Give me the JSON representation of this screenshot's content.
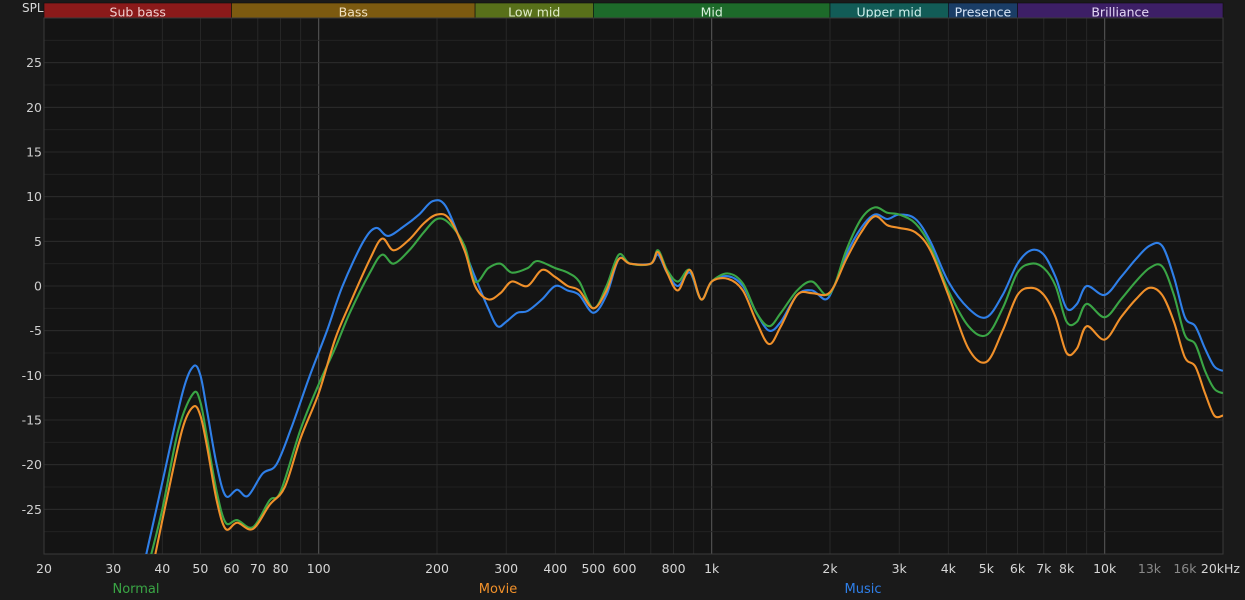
{
  "spl_label": "SPL",
  "bands": [
    {
      "label": "Sub bass",
      "from": 20,
      "to": 60,
      "color": "#8b1a1a",
      "text_color": "#f0d0d0"
    },
    {
      "label": "Bass",
      "from": 60,
      "to": 250,
      "color": "#7c5a10",
      "text_color": "#f0e0c0"
    },
    {
      "label": "Low mid",
      "from": 250,
      "to": 500,
      "color": "#58701a",
      "text_color": "#e0ecc8"
    },
    {
      "label": "Mid",
      "from": 500,
      "to": 2000,
      "color": "#1d6a2a",
      "text_color": "#d8f0dc"
    },
    {
      "label": "Upper mid",
      "from": 2000,
      "to": 4000,
      "color": "#125c57",
      "text_color": "#d0f0ec"
    },
    {
      "label": "Presence",
      "from": 4000,
      "to": 6000,
      "color": "#1a3d66",
      "text_color": "#d8e6f8"
    },
    {
      "label": "Brilliance",
      "from": 6000,
      "to": 20000,
      "color": "#3d1f66",
      "text_color": "#e4d8f6"
    }
  ],
  "legend": [
    {
      "label": "Normal",
      "color": "#3aa545"
    },
    {
      "label": "Movie",
      "color": "#f0902a"
    },
    {
      "label": "Music",
      "color": "#2f7fe8"
    }
  ],
  "chart_data": {
    "type": "line",
    "xscale": "log",
    "xlim": [
      20,
      20000
    ],
    "ylim": [
      -30,
      30
    ],
    "grid": true,
    "ylabel": "SPL",
    "yticks": [
      25,
      20,
      15,
      10,
      5,
      0,
      -5,
      -10,
      -15,
      -20,
      -25
    ],
    "xticks": [
      {
        "v": 20,
        "label": "20",
        "dim": false
      },
      {
        "v": 30,
        "label": "30",
        "dim": false
      },
      {
        "v": 40,
        "label": "40",
        "dim": false
      },
      {
        "v": 50,
        "label": "50",
        "dim": false
      },
      {
        "v": 60,
        "label": "60",
        "dim": false
      },
      {
        "v": 70,
        "label": "70",
        "dim": false
      },
      {
        "v": 80,
        "label": "80",
        "dim": false
      },
      {
        "v": 100,
        "label": "100",
        "dim": false
      },
      {
        "v": 200,
        "label": "200",
        "dim": false
      },
      {
        "v": 300,
        "label": "300",
        "dim": false
      },
      {
        "v": 400,
        "label": "400",
        "dim": false
      },
      {
        "v": 500,
        "label": "500",
        "dim": false
      },
      {
        "v": 600,
        "label": "600",
        "dim": false
      },
      {
        "v": 800,
        "label": "800",
        "dim": false
      },
      {
        "v": 1000,
        "label": "1k",
        "dim": false
      },
      {
        "v": 2000,
        "label": "2k",
        "dim": false
      },
      {
        "v": 3000,
        "label": "3k",
        "dim": false
      },
      {
        "v": 4000,
        "label": "4k",
        "dim": false
      },
      {
        "v": 5000,
        "label": "5k",
        "dim": false
      },
      {
        "v": 6000,
        "label": "6k",
        "dim": false
      },
      {
        "v": 7000,
        "label": "7k",
        "dim": false
      },
      {
        "v": 8000,
        "label": "8k",
        "dim": false
      },
      {
        "v": 10000,
        "label": "10k",
        "dim": false
      },
      {
        "v": 13000,
        "label": "13k",
        "dim": true
      },
      {
        "v": 16000,
        "label": "16k",
        "dim": true
      },
      {
        "v": 20000,
        "label": "20kHz",
        "dim": false
      }
    ],
    "series": [
      {
        "name": "Music",
        "color": "#2f7fe8",
        "points": [
          [
            36,
            -31
          ],
          [
            40,
            -22
          ],
          [
            45,
            -12
          ],
          [
            48,
            -9
          ],
          [
            50,
            -10
          ],
          [
            52,
            -14
          ],
          [
            55,
            -20
          ],
          [
            58,
            -23.5
          ],
          [
            62,
            -22.8
          ],
          [
            66,
            -23.5
          ],
          [
            72,
            -21
          ],
          [
            78,
            -20
          ],
          [
            85,
            -16
          ],
          [
            95,
            -10
          ],
          [
            105,
            -5
          ],
          [
            115,
            0
          ],
          [
            130,
            5
          ],
          [
            140,
            6.5
          ],
          [
            150,
            5.6
          ],
          [
            165,
            6.7
          ],
          [
            180,
            8
          ],
          [
            195,
            9.5
          ],
          [
            210,
            9
          ],
          [
            230,
            5
          ],
          [
            250,
            1
          ],
          [
            270,
            -2.5
          ],
          [
            285,
            -4.5
          ],
          [
            300,
            -4
          ],
          [
            320,
            -3
          ],
          [
            340,
            -2.8
          ],
          [
            370,
            -1.5
          ],
          [
            400,
            0
          ],
          [
            430,
            -0.5
          ],
          [
            460,
            -1
          ],
          [
            500,
            -3
          ],
          [
            540,
            -1
          ],
          [
            580,
            3
          ],
          [
            620,
            2.5
          ],
          [
            700,
            2.5
          ],
          [
            730,
            3.5
          ],
          [
            770,
            1.5
          ],
          [
            820,
            0
          ],
          [
            880,
            1.5
          ],
          [
            940,
            -1.5
          ],
          [
            1000,
            0.5
          ],
          [
            1100,
            1.1
          ],
          [
            1200,
            0
          ],
          [
            1300,
            -3
          ],
          [
            1400,
            -5
          ],
          [
            1500,
            -4
          ],
          [
            1650,
            -1
          ],
          [
            1800,
            -0.5
          ],
          [
            1950,
            -1.5
          ],
          [
            2050,
            0
          ],
          [
            2200,
            3.5
          ],
          [
            2400,
            6.5
          ],
          [
            2600,
            8
          ],
          [
            2800,
            7.5
          ],
          [
            3000,
            8
          ],
          [
            3300,
            7.5
          ],
          [
            3600,
            5
          ],
          [
            4000,
            0.5
          ],
          [
            4500,
            -2.5
          ],
          [
            5000,
            -3.5
          ],
          [
            5500,
            -1
          ],
          [
            6000,
            2.5
          ],
          [
            6500,
            4
          ],
          [
            7000,
            3.5
          ],
          [
            7500,
            1
          ],
          [
            8000,
            -2.5
          ],
          [
            8500,
            -2
          ],
          [
            9000,
            0
          ],
          [
            10000,
            -1
          ],
          [
            11000,
            1
          ],
          [
            12000,
            3
          ],
          [
            13000,
            4.5
          ],
          [
            14000,
            4.5
          ],
          [
            15000,
            1
          ],
          [
            16000,
            -3.5
          ],
          [
            17000,
            -4.5
          ],
          [
            18000,
            -7
          ],
          [
            19000,
            -9
          ],
          [
            20000,
            -9.5
          ]
        ]
      },
      {
        "name": "Normal",
        "color": "#3aa545",
        "points": [
          [
            37,
            -31
          ],
          [
            40,
            -25
          ],
          [
            44,
            -16
          ],
          [
            48,
            -12
          ],
          [
            50,
            -13
          ],
          [
            52,
            -17
          ],
          [
            55,
            -23
          ],
          [
            58,
            -26.5
          ],
          [
            62,
            -26.2
          ],
          [
            68,
            -27
          ],
          [
            75,
            -24
          ],
          [
            80,
            -23
          ],
          [
            90,
            -16
          ],
          [
            100,
            -11
          ],
          [
            110,
            -7
          ],
          [
            120,
            -3
          ],
          [
            135,
            1.5
          ],
          [
            145,
            3.5
          ],
          [
            155,
            2.5
          ],
          [
            170,
            4
          ],
          [
            185,
            6
          ],
          [
            200,
            7.5
          ],
          [
            215,
            7
          ],
          [
            235,
            4.5
          ],
          [
            250,
            0.5
          ],
          [
            270,
            2
          ],
          [
            290,
            2.5
          ],
          [
            310,
            1.5
          ],
          [
            340,
            2
          ],
          [
            360,
            2.8
          ],
          [
            400,
            2
          ],
          [
            430,
            1.5
          ],
          [
            460,
            0.5
          ],
          [
            500,
            -2.5
          ],
          [
            540,
            0
          ],
          [
            580,
            3.5
          ],
          [
            620,
            2.5
          ],
          [
            700,
            2.5
          ],
          [
            730,
            4
          ],
          [
            770,
            1.8
          ],
          [
            820,
            0.5
          ],
          [
            880,
            1.8
          ],
          [
            940,
            -1.5
          ],
          [
            1000,
            0.5
          ],
          [
            1100,
            1.4
          ],
          [
            1200,
            0.3
          ],
          [
            1300,
            -3
          ],
          [
            1400,
            -4.5
          ],
          [
            1500,
            -3
          ],
          [
            1650,
            -0.5
          ],
          [
            1800,
            0.5
          ],
          [
            1950,
            -1
          ],
          [
            2050,
            0
          ],
          [
            2200,
            4
          ],
          [
            2400,
            7.5
          ],
          [
            2600,
            8.8
          ],
          [
            2800,
            8.2
          ],
          [
            3000,
            8
          ],
          [
            3300,
            7
          ],
          [
            3600,
            4.5
          ],
          [
            4000,
            -0.5
          ],
          [
            4500,
            -4.5
          ],
          [
            5000,
            -5.5
          ],
          [
            5500,
            -2.5
          ],
          [
            6000,
            1.5
          ],
          [
            6500,
            2.5
          ],
          [
            7000,
            2
          ],
          [
            7500,
            0
          ],
          [
            8000,
            -4
          ],
          [
            8500,
            -4
          ],
          [
            9000,
            -2
          ],
          [
            10000,
            -3.5
          ],
          [
            11000,
            -1.5
          ],
          [
            12000,
            0.5
          ],
          [
            13000,
            2
          ],
          [
            14000,
            2.2
          ],
          [
            15000,
            -1
          ],
          [
            16000,
            -5.5
          ],
          [
            17000,
            -6.5
          ],
          [
            18000,
            -9.5
          ],
          [
            19000,
            -11.5
          ],
          [
            20000,
            -12
          ]
        ]
      },
      {
        "name": "Movie",
        "color": "#f0902a",
        "points": [
          [
            38,
            -31
          ],
          [
            41,
            -24
          ],
          [
            45,
            -16
          ],
          [
            48,
            -13.5
          ],
          [
            50,
            -14.5
          ],
          [
            52,
            -18
          ],
          [
            55,
            -24
          ],
          [
            58,
            -27.2
          ],
          [
            62,
            -26.5
          ],
          [
            68,
            -27.2
          ],
          [
            75,
            -24.5
          ],
          [
            82,
            -22.5
          ],
          [
            90,
            -17
          ],
          [
            100,
            -12
          ],
          [
            110,
            -6
          ],
          [
            120,
            -2
          ],
          [
            135,
            3
          ],
          [
            145,
            5.3
          ],
          [
            155,
            4
          ],
          [
            170,
            5.2
          ],
          [
            185,
            7
          ],
          [
            200,
            8
          ],
          [
            215,
            7.5
          ],
          [
            235,
            4
          ],
          [
            250,
            0
          ],
          [
            270,
            -1.5
          ],
          [
            290,
            -0.8
          ],
          [
            310,
            0.5
          ],
          [
            340,
            0
          ],
          [
            370,
            1.8
          ],
          [
            400,
            1
          ],
          [
            430,
            0
          ],
          [
            460,
            -0.5
          ],
          [
            500,
            -2.5
          ],
          [
            540,
            -0.5
          ],
          [
            580,
            3
          ],
          [
            620,
            2.5
          ],
          [
            700,
            2.5
          ],
          [
            730,
            3.8
          ],
          [
            770,
            1.5
          ],
          [
            820,
            -0.5
          ],
          [
            880,
            1.8
          ],
          [
            940,
            -1.5
          ],
          [
            1000,
            0.5
          ],
          [
            1100,
            0.8
          ],
          [
            1200,
            -0.5
          ],
          [
            1300,
            -4
          ],
          [
            1400,
            -6.5
          ],
          [
            1500,
            -4.5
          ],
          [
            1650,
            -1
          ],
          [
            1800,
            -0.8
          ],
          [
            1950,
            -1
          ],
          [
            2050,
            0
          ],
          [
            2200,
            3
          ],
          [
            2400,
            6
          ],
          [
            2600,
            7.8
          ],
          [
            2800,
            6.8
          ],
          [
            3000,
            6.5
          ],
          [
            3300,
            6
          ],
          [
            3600,
            4
          ],
          [
            4000,
            -1
          ],
          [
            4500,
            -7
          ],
          [
            5000,
            -8.5
          ],
          [
            5500,
            -5
          ],
          [
            6000,
            -1
          ],
          [
            6500,
            -0.2
          ],
          [
            7000,
            -1
          ],
          [
            7500,
            -3.5
          ],
          [
            8000,
            -7.5
          ],
          [
            8500,
            -7
          ],
          [
            9000,
            -4.5
          ],
          [
            10000,
            -6
          ],
          [
            11000,
            -3.5
          ],
          [
            12000,
            -1.5
          ],
          [
            13000,
            -0.2
          ],
          [
            14000,
            -1
          ],
          [
            15000,
            -4
          ],
          [
            16000,
            -8
          ],
          [
            17000,
            -9
          ],
          [
            18000,
            -12
          ],
          [
            19000,
            -14.5
          ],
          [
            20000,
            -14.5
          ]
        ]
      }
    ]
  }
}
